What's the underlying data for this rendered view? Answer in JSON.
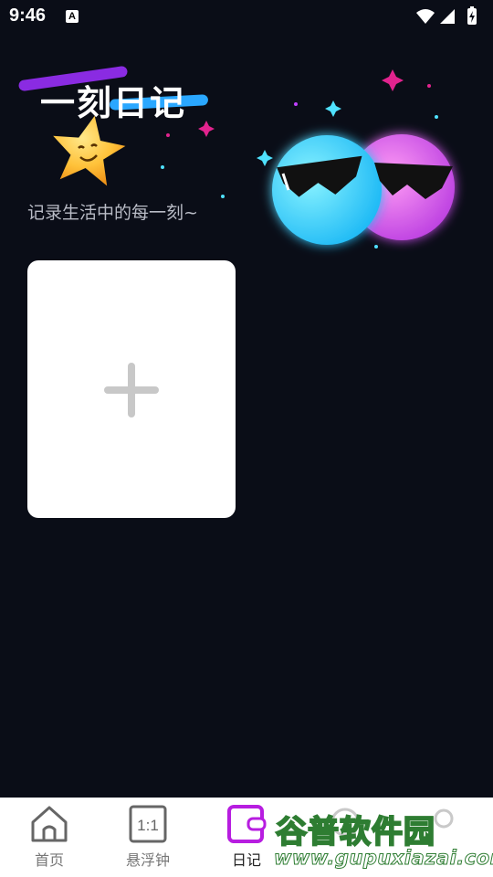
{
  "status_bar": {
    "time": "9:46",
    "notification_icon": "A",
    "icons": [
      "wifi-icon",
      "signal-icon",
      "battery-charging-icon"
    ]
  },
  "header": {
    "title": "一刻日记",
    "subtitle": "记录生活中的每一刻~",
    "mascot_icon": "star-mascot-icon",
    "mascot_group_icon": "sunglasses-balls-icon"
  },
  "add_card": {
    "icon": "plus-icon"
  },
  "bottom_nav": {
    "items": [
      {
        "label": "首页",
        "icon": "home-icon",
        "active": false
      },
      {
        "label": "悬浮钟",
        "icon": "ratio-1-1-icon",
        "active": false
      },
      {
        "label": "日记",
        "icon": "diary-icon",
        "active": true
      },
      {
        "label": "",
        "icon": "hidden-icon",
        "active": false
      },
      {
        "label": "",
        "icon": "hidden-icon",
        "active": false
      }
    ]
  },
  "watermark": {
    "title": "谷普软件园",
    "url": "www.gupuxiazai.com"
  },
  "colors": {
    "background": "#0a0d17",
    "accent": "#b71de0",
    "card": "#ffffff",
    "mascot_cyan": "#3fd8ff",
    "mascot_pink": "#d255f0",
    "star": "#ffc23a"
  }
}
